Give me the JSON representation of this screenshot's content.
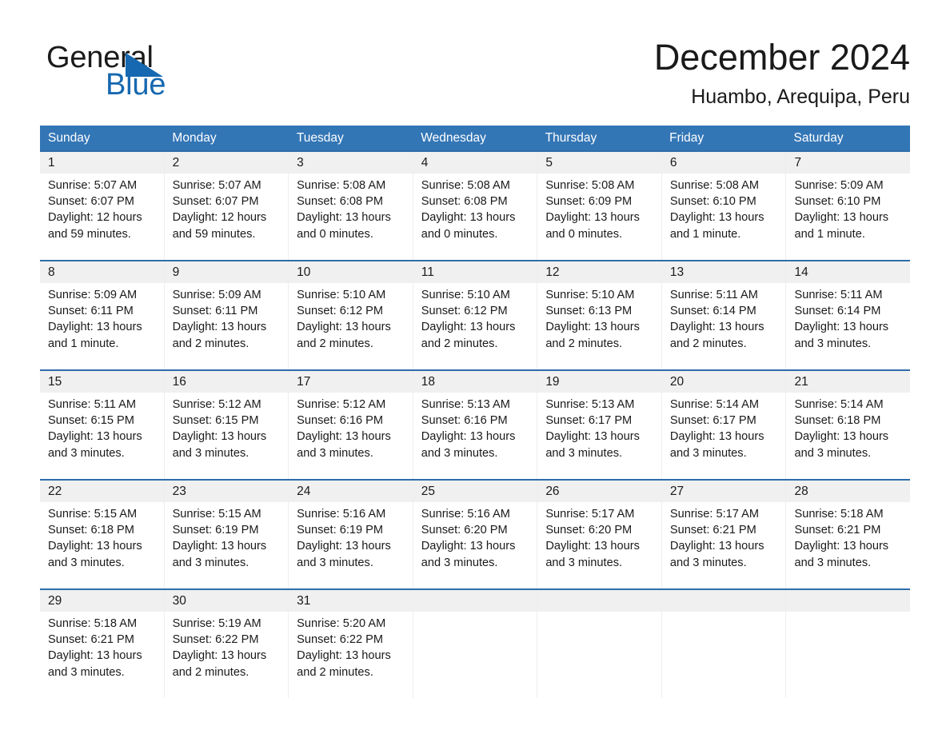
{
  "brand": {
    "name_line1": "General",
    "name_line2": "Blue",
    "accent_color": "#1668b0"
  },
  "header": {
    "title": "December 2024",
    "subtitle": "Huambo, Arequipa, Peru"
  },
  "theme": {
    "header_blue": "#3376b6",
    "rule_blue": "#2f6da9",
    "daynum_band": "#f0f0f0"
  },
  "weekdays": [
    "Sunday",
    "Monday",
    "Tuesday",
    "Wednesday",
    "Thursday",
    "Friday",
    "Saturday"
  ],
  "weeks": [
    {
      "days": [
        {
          "num": "1",
          "sunrise": "Sunrise: 5:07 AM",
          "sunset": "Sunset: 6:07 PM",
          "daylight_l1": "Daylight: 12 hours",
          "daylight_l2": "and 59 minutes."
        },
        {
          "num": "2",
          "sunrise": "Sunrise: 5:07 AM",
          "sunset": "Sunset: 6:07 PM",
          "daylight_l1": "Daylight: 12 hours",
          "daylight_l2": "and 59 minutes."
        },
        {
          "num": "3",
          "sunrise": "Sunrise: 5:08 AM",
          "sunset": "Sunset: 6:08 PM",
          "daylight_l1": "Daylight: 13 hours",
          "daylight_l2": "and 0 minutes."
        },
        {
          "num": "4",
          "sunrise": "Sunrise: 5:08 AM",
          "sunset": "Sunset: 6:08 PM",
          "daylight_l1": "Daylight: 13 hours",
          "daylight_l2": "and 0 minutes."
        },
        {
          "num": "5",
          "sunrise": "Sunrise: 5:08 AM",
          "sunset": "Sunset: 6:09 PM",
          "daylight_l1": "Daylight: 13 hours",
          "daylight_l2": "and 0 minutes."
        },
        {
          "num": "6",
          "sunrise": "Sunrise: 5:08 AM",
          "sunset": "Sunset: 6:10 PM",
          "daylight_l1": "Daylight: 13 hours",
          "daylight_l2": "and 1 minute."
        },
        {
          "num": "7",
          "sunrise": "Sunrise: 5:09 AM",
          "sunset": "Sunset: 6:10 PM",
          "daylight_l1": "Daylight: 13 hours",
          "daylight_l2": "and 1 minute."
        }
      ]
    },
    {
      "days": [
        {
          "num": "8",
          "sunrise": "Sunrise: 5:09 AM",
          "sunset": "Sunset: 6:11 PM",
          "daylight_l1": "Daylight: 13 hours",
          "daylight_l2": "and 1 minute."
        },
        {
          "num": "9",
          "sunrise": "Sunrise: 5:09 AM",
          "sunset": "Sunset: 6:11 PM",
          "daylight_l1": "Daylight: 13 hours",
          "daylight_l2": "and 2 minutes."
        },
        {
          "num": "10",
          "sunrise": "Sunrise: 5:10 AM",
          "sunset": "Sunset: 6:12 PM",
          "daylight_l1": "Daylight: 13 hours",
          "daylight_l2": "and 2 minutes."
        },
        {
          "num": "11",
          "sunrise": "Sunrise: 5:10 AM",
          "sunset": "Sunset: 6:12 PM",
          "daylight_l1": "Daylight: 13 hours",
          "daylight_l2": "and 2 minutes."
        },
        {
          "num": "12",
          "sunrise": "Sunrise: 5:10 AM",
          "sunset": "Sunset: 6:13 PM",
          "daylight_l1": "Daylight: 13 hours",
          "daylight_l2": "and 2 minutes."
        },
        {
          "num": "13",
          "sunrise": "Sunrise: 5:11 AM",
          "sunset": "Sunset: 6:14 PM",
          "daylight_l1": "Daylight: 13 hours",
          "daylight_l2": "and 2 minutes."
        },
        {
          "num": "14",
          "sunrise": "Sunrise: 5:11 AM",
          "sunset": "Sunset: 6:14 PM",
          "daylight_l1": "Daylight: 13 hours",
          "daylight_l2": "and 3 minutes."
        }
      ]
    },
    {
      "days": [
        {
          "num": "15",
          "sunrise": "Sunrise: 5:11 AM",
          "sunset": "Sunset: 6:15 PM",
          "daylight_l1": "Daylight: 13 hours",
          "daylight_l2": "and 3 minutes."
        },
        {
          "num": "16",
          "sunrise": "Sunrise: 5:12 AM",
          "sunset": "Sunset: 6:15 PM",
          "daylight_l1": "Daylight: 13 hours",
          "daylight_l2": "and 3 minutes."
        },
        {
          "num": "17",
          "sunrise": "Sunrise: 5:12 AM",
          "sunset": "Sunset: 6:16 PM",
          "daylight_l1": "Daylight: 13 hours",
          "daylight_l2": "and 3 minutes."
        },
        {
          "num": "18",
          "sunrise": "Sunrise: 5:13 AM",
          "sunset": "Sunset: 6:16 PM",
          "daylight_l1": "Daylight: 13 hours",
          "daylight_l2": "and 3 minutes."
        },
        {
          "num": "19",
          "sunrise": "Sunrise: 5:13 AM",
          "sunset": "Sunset: 6:17 PM",
          "daylight_l1": "Daylight: 13 hours",
          "daylight_l2": "and 3 minutes."
        },
        {
          "num": "20",
          "sunrise": "Sunrise: 5:14 AM",
          "sunset": "Sunset: 6:17 PM",
          "daylight_l1": "Daylight: 13 hours",
          "daylight_l2": "and 3 minutes."
        },
        {
          "num": "21",
          "sunrise": "Sunrise: 5:14 AM",
          "sunset": "Sunset: 6:18 PM",
          "daylight_l1": "Daylight: 13 hours",
          "daylight_l2": "and 3 minutes."
        }
      ]
    },
    {
      "days": [
        {
          "num": "22",
          "sunrise": "Sunrise: 5:15 AM",
          "sunset": "Sunset: 6:18 PM",
          "daylight_l1": "Daylight: 13 hours",
          "daylight_l2": "and 3 minutes."
        },
        {
          "num": "23",
          "sunrise": "Sunrise: 5:15 AM",
          "sunset": "Sunset: 6:19 PM",
          "daylight_l1": "Daylight: 13 hours",
          "daylight_l2": "and 3 minutes."
        },
        {
          "num": "24",
          "sunrise": "Sunrise: 5:16 AM",
          "sunset": "Sunset: 6:19 PM",
          "daylight_l1": "Daylight: 13 hours",
          "daylight_l2": "and 3 minutes."
        },
        {
          "num": "25",
          "sunrise": "Sunrise: 5:16 AM",
          "sunset": "Sunset: 6:20 PM",
          "daylight_l1": "Daylight: 13 hours",
          "daylight_l2": "and 3 minutes."
        },
        {
          "num": "26",
          "sunrise": "Sunrise: 5:17 AM",
          "sunset": "Sunset: 6:20 PM",
          "daylight_l1": "Daylight: 13 hours",
          "daylight_l2": "and 3 minutes."
        },
        {
          "num": "27",
          "sunrise": "Sunrise: 5:17 AM",
          "sunset": "Sunset: 6:21 PM",
          "daylight_l1": "Daylight: 13 hours",
          "daylight_l2": "and 3 minutes."
        },
        {
          "num": "28",
          "sunrise": "Sunrise: 5:18 AM",
          "sunset": "Sunset: 6:21 PM",
          "daylight_l1": "Daylight: 13 hours",
          "daylight_l2": "and 3 minutes."
        }
      ]
    },
    {
      "days": [
        {
          "num": "29",
          "sunrise": "Sunrise: 5:18 AM",
          "sunset": "Sunset: 6:21 PM",
          "daylight_l1": "Daylight: 13 hours",
          "daylight_l2": "and 3 minutes."
        },
        {
          "num": "30",
          "sunrise": "Sunrise: 5:19 AM",
          "sunset": "Sunset: 6:22 PM",
          "daylight_l1": "Daylight: 13 hours",
          "daylight_l2": "and 2 minutes."
        },
        {
          "num": "31",
          "sunrise": "Sunrise: 5:20 AM",
          "sunset": "Sunset: 6:22 PM",
          "daylight_l1": "Daylight: 13 hours",
          "daylight_l2": "and 2 minutes."
        },
        {
          "num": "",
          "sunrise": "",
          "sunset": "",
          "daylight_l1": "",
          "daylight_l2": ""
        },
        {
          "num": "",
          "sunrise": "",
          "sunset": "",
          "daylight_l1": "",
          "daylight_l2": ""
        },
        {
          "num": "",
          "sunrise": "",
          "sunset": "",
          "daylight_l1": "",
          "daylight_l2": ""
        },
        {
          "num": "",
          "sunrise": "",
          "sunset": "",
          "daylight_l1": "",
          "daylight_l2": ""
        }
      ]
    }
  ]
}
